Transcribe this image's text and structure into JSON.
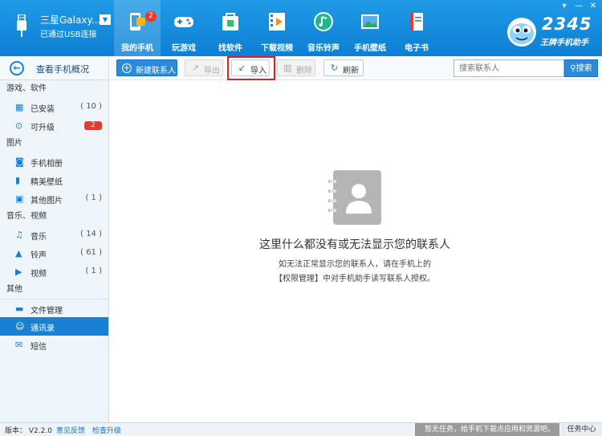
{
  "header": {
    "device_name": "三星Galaxy...",
    "device_status": "已通过USB连接",
    "nav": [
      {
        "label": "我的手机",
        "icon": "phone-icon",
        "badge": "2"
      },
      {
        "label": "玩游戏",
        "icon": "gamepad-icon"
      },
      {
        "label": "找软件",
        "icon": "app-bag-icon"
      },
      {
        "label": "下载视频",
        "icon": "video-film-icon"
      },
      {
        "label": "音乐铃声",
        "icon": "music-note-icon"
      },
      {
        "label": "手机壁纸",
        "icon": "wallpaper-icon"
      },
      {
        "label": "电子书",
        "icon": "book-icon"
      }
    ],
    "brand_number": "2345",
    "brand_sub": "王牌手机助手",
    "window_controls": [
      "▾",
      "—",
      "✕"
    ]
  },
  "sidebar": {
    "back_label": "查看手机概况",
    "groups": [
      {
        "title": "游戏、软件",
        "items": [
          {
            "label": "已安装",
            "count": "( 10 )",
            "icon": "grid-icon"
          },
          {
            "label": "可升级",
            "badge": "2",
            "icon": "upgrade-icon"
          }
        ]
      },
      {
        "title": "图片",
        "items": [
          {
            "label": "手机相册",
            "icon": "camera-icon"
          },
          {
            "label": "精美壁纸",
            "icon": "phone-wallpaper-icon"
          },
          {
            "label": "其他图片",
            "count": "( 1 )",
            "icon": "image-icon"
          }
        ]
      },
      {
        "title": "音乐、视频",
        "items": [
          {
            "label": "音乐",
            "count": "( 14 )",
            "icon": "music-icon"
          },
          {
            "label": "铃声",
            "count": "( 61 )",
            "icon": "bell-icon"
          },
          {
            "label": "视频",
            "count": "( 1 )",
            "icon": "play-icon"
          }
        ]
      },
      {
        "title": "其他",
        "items": [
          {
            "label": "文件管理",
            "icon": "folder-icon"
          },
          {
            "label": "通讯录",
            "icon": "contacts-icon",
            "active": true
          },
          {
            "label": "短信",
            "icon": "mail-icon"
          }
        ]
      }
    ]
  },
  "toolbar": {
    "new_contact": "新建联系人",
    "export": "导出",
    "import": "导入",
    "delete": "删除",
    "refresh": "刷新",
    "search_placeholder": "搜索联系人",
    "search_button": "搜索"
  },
  "empty_state": {
    "title": "这里什么都没有或无法显示您的联系人",
    "line1": "如无法正常显示您的联系人，请在手机上的",
    "line2": "【权限管理】中对手机助手读写联系人授权。"
  },
  "statusbar": {
    "version": "版本： V2.2.0",
    "feedback": "意见反馈",
    "check_update": "检查升级",
    "task_status": "暂无任务，给手机下载点应用和资源吧。",
    "task_center": "任务中心"
  }
}
